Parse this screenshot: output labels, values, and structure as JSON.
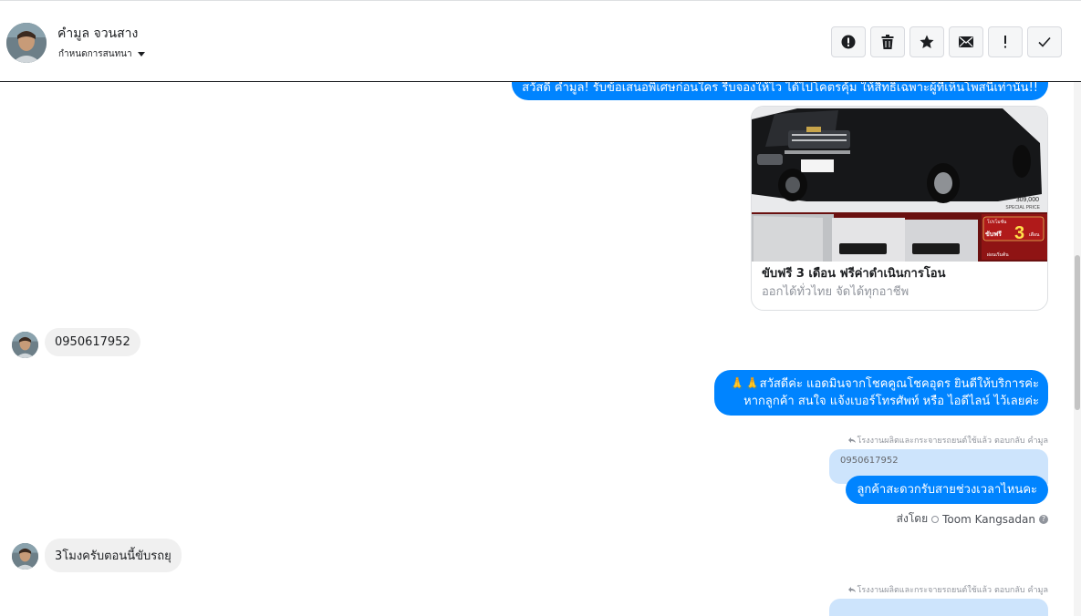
{
  "header": {
    "contact_name": "คำมูล จวนสาง",
    "conversation_label": "กำหนดการสนทนา",
    "actions": [
      {
        "name": "report-spam-button",
        "icon": "alert-circle-icon"
      },
      {
        "name": "delete-button",
        "icon": "trash-icon"
      },
      {
        "name": "star-button",
        "icon": "star-icon"
      },
      {
        "name": "mark-unread-button",
        "icon": "envelope-icon"
      },
      {
        "name": "flag-button",
        "icon": "exclamation-icon"
      },
      {
        "name": "mark-done-button",
        "icon": "check-icon"
      }
    ]
  },
  "messages": {
    "greeting": "สวัสดี คำมูล! รับข้อเสนอพิเศษก่อนใคร รีบจองให้ไว ได้ไปโคตรคุ้ม ให้สิทธิเฉพาะผู้ที่เห็นโพสนี้เท่านั้น!!",
    "card": {
      "title": "ขับฟรี 3 เดือน ฟรีค่าดำเนินการโอน",
      "subtitle": "ออกได้ทั่วไทย จัดได้ทุกอาชีพ",
      "image_price": "309,000",
      "image_price_label": "SPECIAL PRICE",
      "image_promo_top": "โปรโมชั่น",
      "image_promo_main": "ขับฟรี",
      "image_promo_num": "3",
      "image_promo_unit": "เดือน",
      "image_promo_bottom": "ผ่อนเริ่มต้น"
    },
    "customer_phone": "0950617952",
    "admin_reply_line1": "🙏🙏สวัสดีค่ะ แอดมินจากโชคคูณโชคอุดร ยินดีให้บริการค่ะ",
    "admin_reply_line2": "หากลูกค้า สนใจ แจ้งเบอร์โทรศัพท์ หรือ ไอดีไลน์  ไว้เลยค่ะ",
    "reply_note_1": "โรงงานผลิตและกระจายรถยนต์ใช้แล้ว ตอบกลับ คำมูล",
    "quoted_text_1": "0950617952",
    "admin_question": "ลูกค้าสะดวกรับสายช่วงเวลาไหนคะ",
    "sent_by_label": "ส่งโดย",
    "sent_by_name": "Toom Kangsadan",
    "customer_reply_2": "3โมงครับตอนนี้ขับรถยุ",
    "reply_note_2": "โรงงานผลิตและกระจายรถยนต์ใช้แล้ว ตอบกลับ คำมูล"
  },
  "colors": {
    "outgoing_bubble": "#0084ff",
    "incoming_bubble": "#f0f0f0",
    "quote_bubble": "#cde4fc"
  }
}
